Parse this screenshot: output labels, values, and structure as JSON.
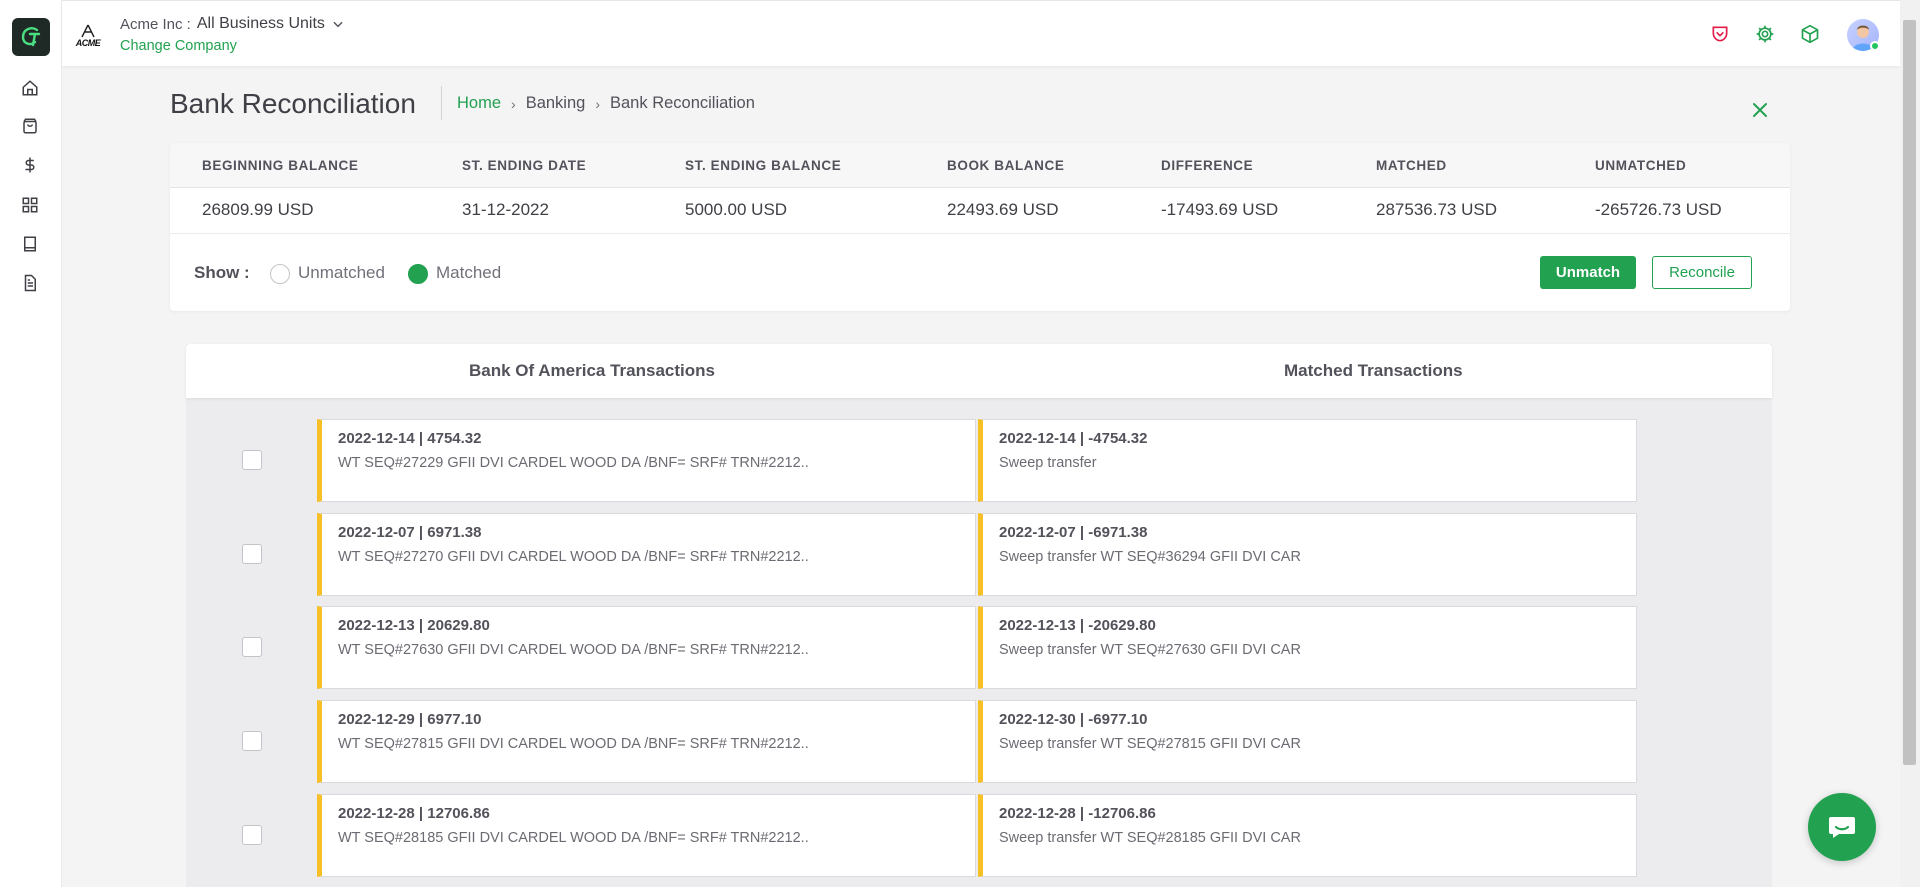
{
  "sidebar": {
    "items": [
      {
        "icon": "home-icon"
      },
      {
        "icon": "shopping-bag-icon"
      },
      {
        "icon": "dollar-icon"
      },
      {
        "icon": "apps-grid-icon"
      },
      {
        "icon": "book-icon"
      },
      {
        "icon": "document-icon"
      }
    ]
  },
  "header": {
    "logo_text": "ACME",
    "company_name": "Acme Inc :",
    "business_unit": "All Business Units",
    "change_company": "Change Company",
    "icons": [
      "pocket-icon",
      "settings-gear-icon",
      "cube-icon"
    ],
    "accent_color": "#22a150",
    "alert_icon_color": "#e11d48"
  },
  "page": {
    "title": "Bank Reconciliation",
    "breadcrumb": [
      "Home",
      "Banking",
      "Bank Reconciliation"
    ]
  },
  "summary": {
    "headers": [
      "BEGINNING BALANCE",
      "ST. ENDING DATE",
      "ST. ENDING BALANCE",
      "BOOK BALANCE",
      "DIFFERENCE",
      "MATCHED",
      "UNMATCHED"
    ],
    "values": [
      "26809.99 USD",
      "31-12-2022",
      "5000.00 USD",
      "22493.69 USD",
      "-17493.69 USD",
      "287536.73 USD",
      "-265726.73 USD"
    ]
  },
  "filter": {
    "label": "Show :",
    "options": [
      "Unmatched",
      "Matched"
    ],
    "selected": "Matched"
  },
  "actions": {
    "unmatch": "Unmatch",
    "reconcile": "Reconcile"
  },
  "transactions": {
    "bank_title": "Bank Of America Transactions",
    "matched_title": "Matched Transactions",
    "card_accent": "#f6c026",
    "rows": [
      {
        "bank": {
          "title": "2022-12-14 |  4754.32",
          "desc": "WT SEQ#27229 GFII DVI CARDEL WOOD DA /BNF= SRF# TRN#2212.."
        },
        "matched": {
          "title": "2022-12-14 |  -4754.32",
          "desc": "Sweep transfer"
        }
      },
      {
        "bank": {
          "title": "2022-12-07 |  6971.38",
          "desc": "WT SEQ#27270 GFII DVI CARDEL WOOD DA /BNF= SRF# TRN#2212.."
        },
        "matched": {
          "title": "2022-12-07 |  -6971.38",
          "desc": "Sweep transfer WT SEQ#36294 GFII DVI CAR"
        }
      },
      {
        "bank": {
          "title": "2022-12-13 |  20629.80",
          "desc": "WT SEQ#27630 GFII DVI CARDEL WOOD DA /BNF= SRF# TRN#2212.."
        },
        "matched": {
          "title": "2022-12-13 |  -20629.80",
          "desc": "Sweep transfer WT SEQ#27630 GFII DVI CAR"
        }
      },
      {
        "bank": {
          "title": "2022-12-29 |  6977.10",
          "desc": "WT SEQ#27815 GFII DVI CARDEL WOOD DA /BNF= SRF# TRN#2212.."
        },
        "matched": {
          "title": "2022-12-30 |  -6977.10",
          "desc": "Sweep transfer WT SEQ#27815 GFII DVI CAR"
        }
      },
      {
        "bank": {
          "title": "2022-12-28 |  12706.86",
          "desc": "WT SEQ#28185 GFII DVI CARDEL WOOD DA /BNF= SRF# TRN#2212.."
        },
        "matched": {
          "title": "2022-12-28 |  -12706.86",
          "desc": "Sweep transfer WT SEQ#28185 GFII DVI CAR"
        }
      }
    ]
  }
}
